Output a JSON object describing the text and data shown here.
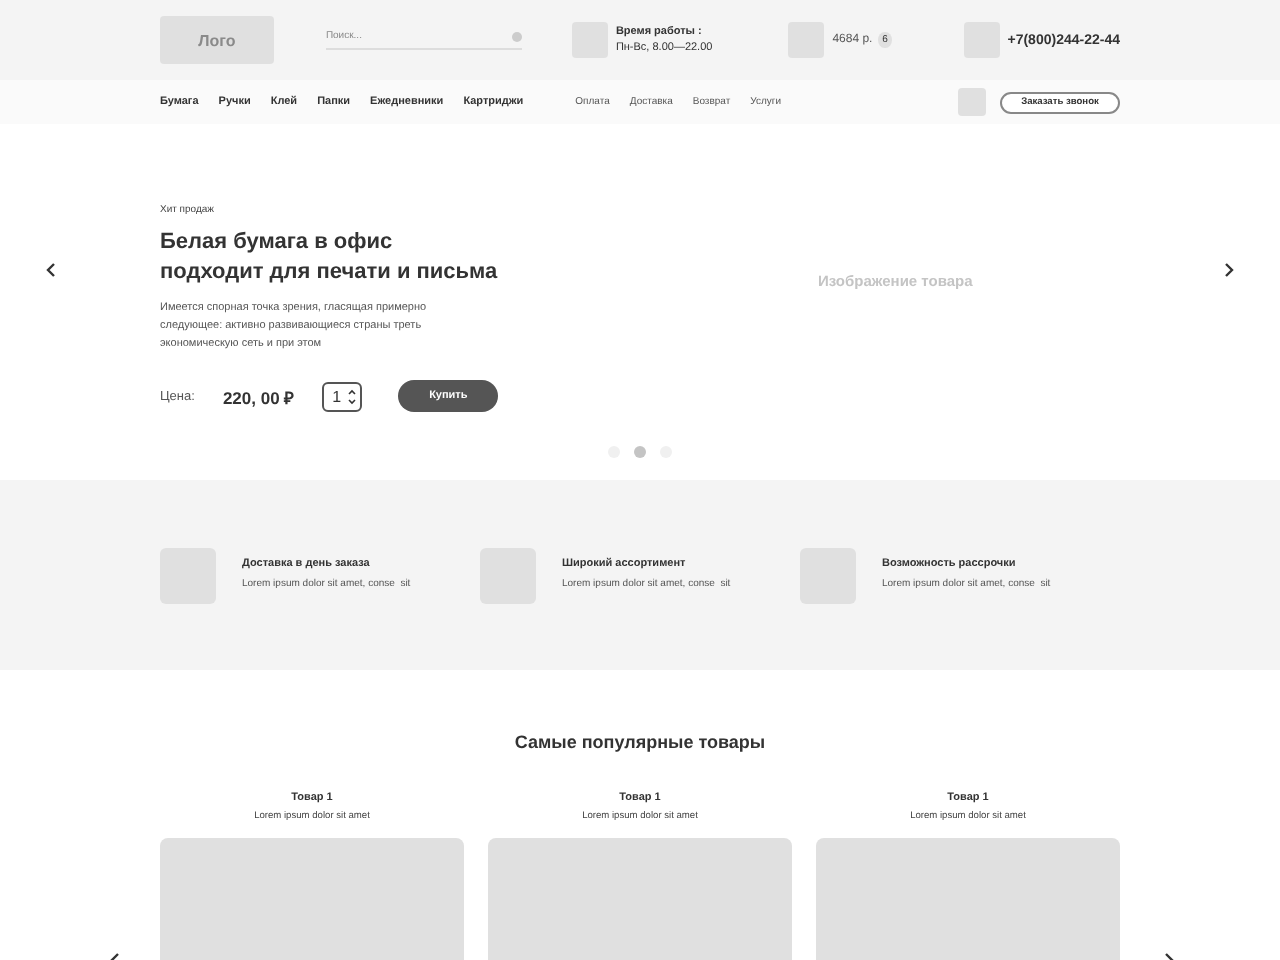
{
  "header": {
    "logo": "Лого",
    "search": {
      "placeholder": "Поиск..."
    },
    "hours": {
      "label": "Время работы :",
      "value": "Пн-Вс, 8.00—22.00"
    },
    "cart": {
      "amount": "4684 р.",
      "count": "6"
    },
    "phone": "+7(800)244-22-44"
  },
  "nav": {
    "categories": [
      "Бумага",
      "Ручки",
      "Клей",
      "Папки",
      "Ежедневники",
      "Картриджи"
    ],
    "links": [
      "Оплата",
      "Доставка",
      "Возврат",
      "Услуги"
    ],
    "callback_button": "Заказать звонок"
  },
  "hero": {
    "tag": "Хит продаж",
    "title_lines": [
      "Белая бумага в офис",
      "подходит для печати и письма"
    ],
    "description": "Имеется спорная точка зрения, гласящая примерно следующее: активно развивающиеся страны треть экономическую сеть и при этом",
    "price_label": "Цена:",
    "price": "220, 00 ₽",
    "quantity": "1",
    "buy_button": "Купить",
    "image_label": "Изображение товара",
    "dots": [
      {
        "selected": false
      },
      {
        "selected": true
      },
      {
        "selected": false
      }
    ]
  },
  "features": [
    {
      "title": "Доставка в день заказа",
      "text": "Lorem ipsum dolor sit amet, conse  sit"
    },
    {
      "title": "Широкий ассортимент",
      "text": "Lorem ipsum dolor sit amet, conse  sit"
    },
    {
      "title": "Возможность рассрочки",
      "text": "Lorem ipsum dolor sit amet, conse  sit"
    }
  ],
  "popular": {
    "title": "Самые популярные товары",
    "products": [
      {
        "name": "Товар 1",
        "description": "Lorem ipsum dolor sit amet"
      },
      {
        "name": "Товар 1",
        "description": "Lorem ipsum dolor sit amet"
      },
      {
        "name": "Товар 1",
        "description": "Lorem ipsum dolor sit amet"
      }
    ]
  }
}
